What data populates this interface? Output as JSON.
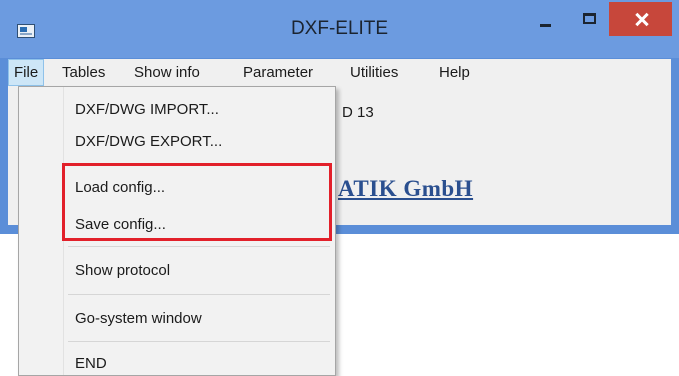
{
  "window": {
    "title": "DXF-ELITE"
  },
  "menubar": {
    "items": [
      "File",
      "Tables",
      "Show info",
      "Parameter",
      "Utilities",
      "Help"
    ]
  },
  "client": {
    "partial_text": "D 13",
    "brand_partial": "ATIK GmbH"
  },
  "file_menu": {
    "items": [
      "DXF/DWG IMPORT...",
      "DXF/DWG EXPORT...",
      "Load config...",
      "Save config...",
      "Show protocol",
      "Go-system window",
      "END"
    ]
  },
  "colors": {
    "title_bar": "#6c9be0",
    "close_button": "#c7473b",
    "highlight": "#e2202a",
    "brand_text": "#2a4f8f"
  }
}
